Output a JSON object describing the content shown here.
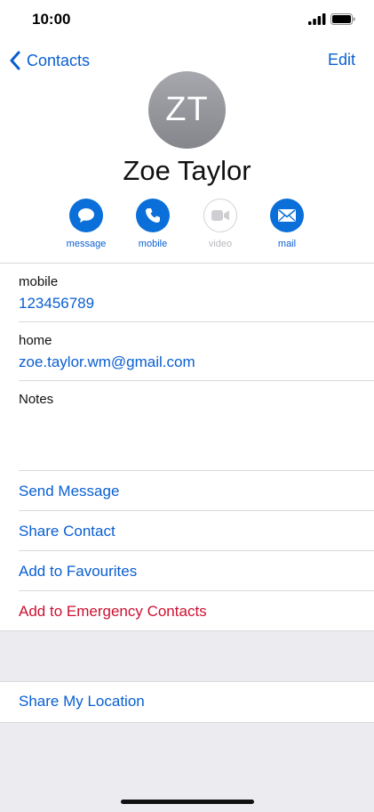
{
  "status_bar": {
    "time": "10:00"
  },
  "nav": {
    "back_label": "Contacts",
    "edit_label": "Edit"
  },
  "contact": {
    "initials": "ZT",
    "name": "Zoe Taylor"
  },
  "actions": [
    {
      "label": "message",
      "enabled": true
    },
    {
      "label": "mobile",
      "enabled": true
    },
    {
      "label": "video",
      "enabled": false
    },
    {
      "label": "mail",
      "enabled": true
    }
  ],
  "fields": [
    {
      "label": "mobile",
      "value": "123456789"
    },
    {
      "label": "home",
      "value": "zoe.taylor.wm@gmail.com"
    }
  ],
  "notes": {
    "label": "Notes"
  },
  "menu": {
    "send_message": "Send Message",
    "share_contact": "Share Contact",
    "add_favourites": "Add to Favourites",
    "add_emergency": "Add to Emergency Contacts",
    "share_location": "Share My Location"
  },
  "colors": {
    "accent": "#0a5fd1",
    "danger": "#cc1130",
    "grouped_bg": "#ebebf0"
  }
}
